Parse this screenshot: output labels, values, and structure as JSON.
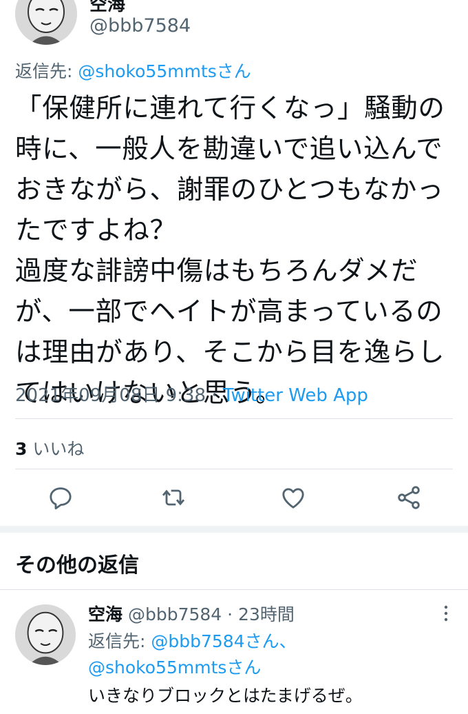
{
  "tweet": {
    "author_name": "空海",
    "author_handle": "@bbb7584",
    "reply_to_label": "返信先: ",
    "reply_to_handle": "@shoko55mmtsさん",
    "lines": [
      "「保健所に連れて行くなっ」騒動の",
      "時に、一般人を勘違いで追い込んで",
      "おきながら、謝罪のひとつもなかっ",
      "たですよね？",
      "過度な誹謗中傷はもちろんダメだ",
      "が、一部でヘイトが高まっているの",
      "は理由があり、そこから目を逸らし",
      "てはいけないと思う。"
    ],
    "timestamp": "2021年09月08日 9:38 · ",
    "source_app": "Twitter Web App",
    "like_count": "3",
    "like_label": " いいね"
  },
  "actions": {
    "reply_icon": "reply-icon",
    "retweet_icon": "retweet-icon",
    "like_icon": "heart-icon",
    "share_icon": "share-icon"
  },
  "section": {
    "title": "その他の返信"
  },
  "reply": {
    "author_name": "空海",
    "author_handle": " @bbb7584 · 23時間",
    "reply_to_label": "返信先: ",
    "reply_to_handle_1": "@bbb7584さん、",
    "reply_to_handle_2": "@shoko55mmtsさん",
    "text": "いきなりブロックとはたまげるぜ。"
  },
  "colors": {
    "link": "#1d9bf0",
    "secondary_text": "#536471",
    "primary_text": "#0f1419"
  }
}
